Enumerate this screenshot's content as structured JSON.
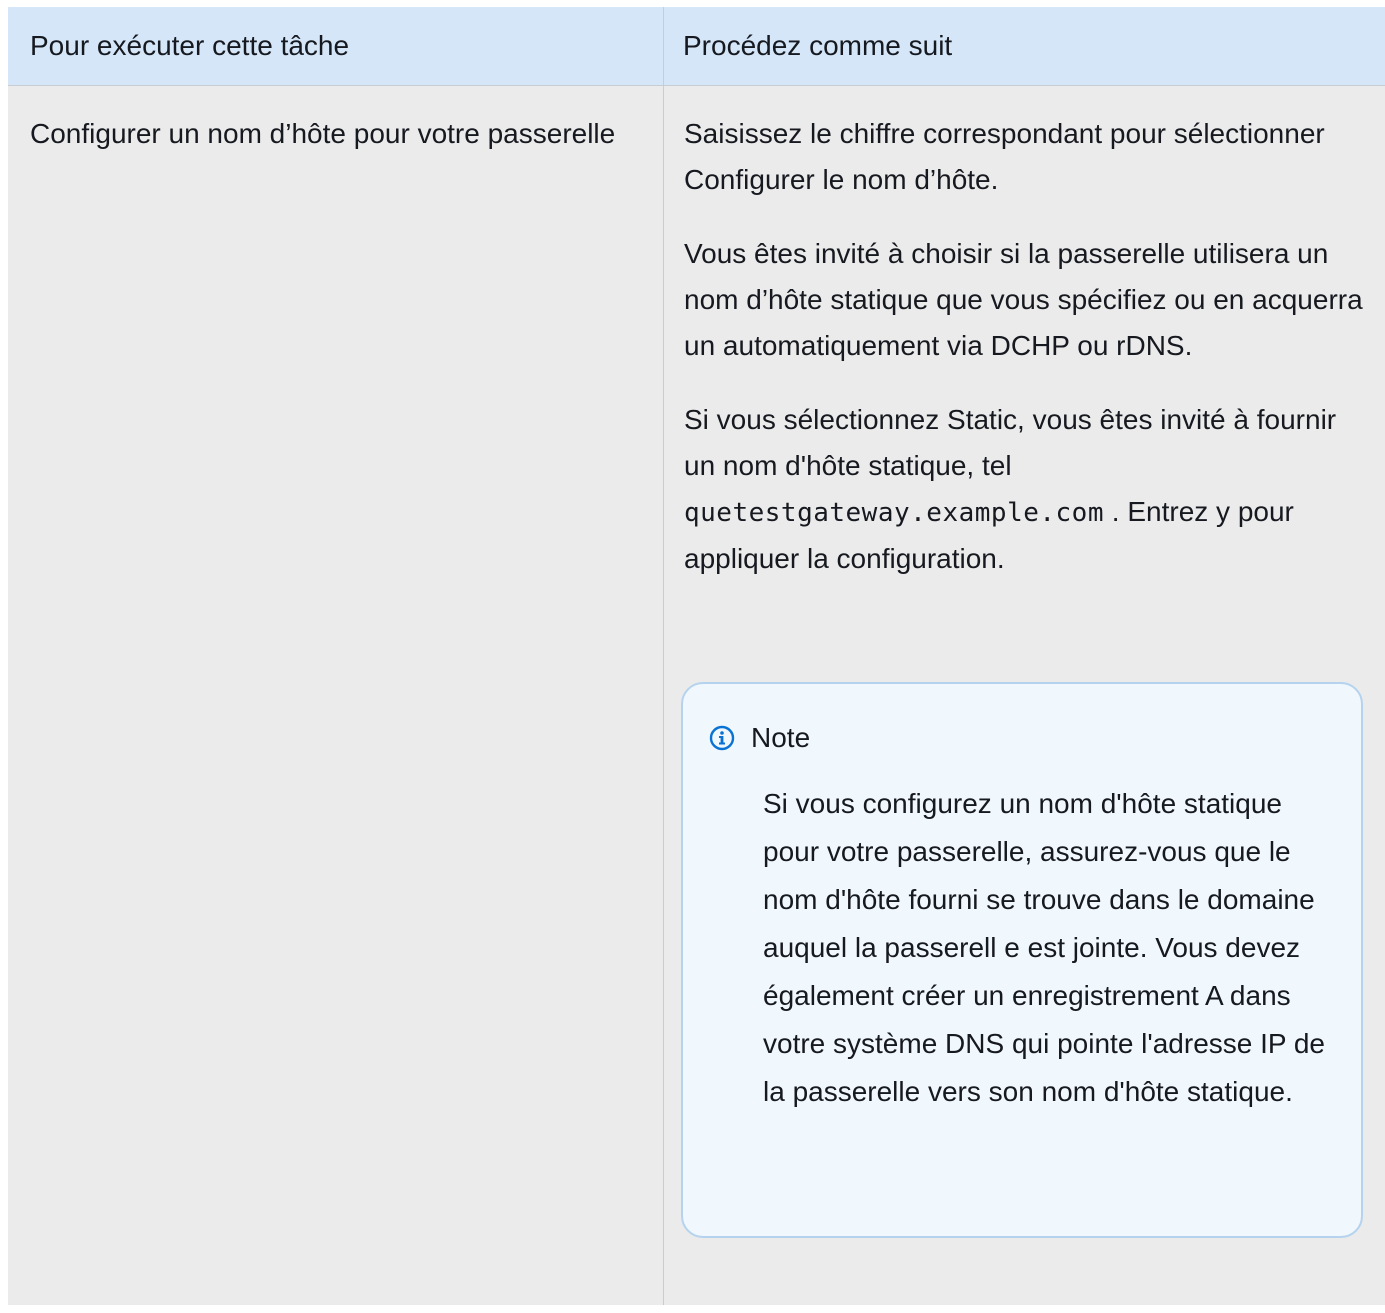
{
  "table": {
    "headers": [
      "Pour exécuter cette tâche",
      "Procédez comme suit"
    ],
    "row": {
      "task": "Configurer un nom d’hôte pour votre passerelle",
      "steps": {
        "p1": "Saisissez le chiffre correspondant pour sélectionner Configurer le nom d’hôte.",
        "p2": "Vous êtes invité à choisir si la passerelle utilisera un nom d’hôte statique que vous spécifiez ou en acquerra un automatiquement via DCHP ou rDNS.",
        "p3_before": "Si vous sélectionnez Static, vous êtes invité à fournir un nom d'hôte statique, tel",
        "p3_code": "quetestgateway.example.com",
        "p3_after": ". Entrez y pour appliquer la configuration."
      }
    }
  },
  "note": {
    "icon": "info-icon",
    "title": "Note",
    "body": "Si vous configurez un nom d'hôte statique pour votre passerelle, assurez-vous que le nom d'hôte fourni se trouve dans le domaine auquel la passerell e est jointe. Vous devez également créer un enregistrement A dans votre système DNS qui pointe l'adresse IP de la passerelle vers son nom d'hôte statique."
  },
  "colors": {
    "header_bg": "#d5e6f8",
    "cell_bg": "#ebebeb",
    "note_bg": "#f0f7fd",
    "note_border": "#b5d3ee",
    "info_icon": "#0972d3"
  }
}
